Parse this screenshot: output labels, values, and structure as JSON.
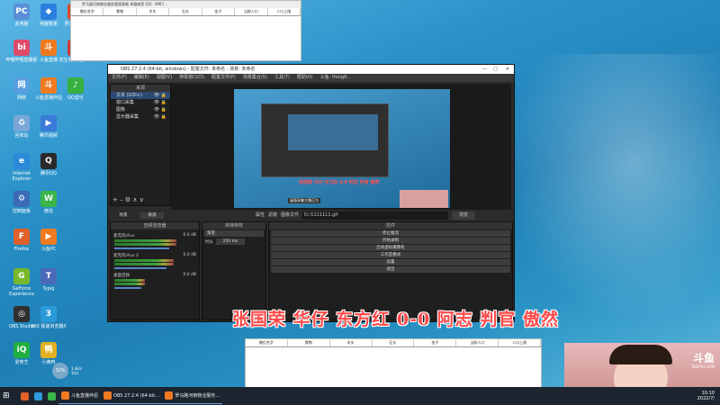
{
  "desktop_icons": [
    {
      "label": "此电脑",
      "color": "#5a8fd8",
      "glyph": "PC"
    },
    {
      "label": "电脑管家",
      "color": "#2a7fe0",
      "glyph": "◆"
    },
    {
      "label": "罗马路河南",
      "color": "#d84a2a",
      "glyph": "罗"
    },
    {
      "label": "哔哩哔哩直播姬",
      "color": "#e04a6a",
      "glyph": "bi"
    },
    {
      "label": "斗鱼直播",
      "color": "#f07a20",
      "glyph": "斗"
    },
    {
      "label": "花生壳 开始Live",
      "color": "#d23a3a",
      "glyph": "花"
    },
    {
      "label": "网络",
      "color": "#5aa0e0",
      "glyph": "网"
    },
    {
      "label": "斗鱼直播伴侣",
      "color": "#f07a20",
      "glyph": "斗"
    },
    {
      "label": "QQ音乐",
      "color": "#38b040",
      "glyph": "♪"
    },
    {
      "label": "回收站",
      "color": "#7aa7d8",
      "glyph": "♻"
    },
    {
      "label": "腾讯视频",
      "color": "#3a7ad8",
      "glyph": "▶"
    },
    {
      "label": "Internet Explorer",
      "color": "#2a8ad8",
      "glyph": "e"
    },
    {
      "label": "腾讯QQ",
      "color": "#2a2a2a",
      "glyph": "Q"
    },
    {
      "label": "控制面板",
      "color": "#3a6ab8",
      "glyph": "⚙"
    },
    {
      "label": "微信",
      "color": "#3ab54a",
      "glyph": "W"
    },
    {
      "label": "Firefox",
      "color": "#e0602a",
      "glyph": "F"
    },
    {
      "label": "斗鱼PC",
      "color": "#f07a20",
      "glyph": "▶"
    },
    {
      "label": "GeForce Experience",
      "color": "#76b82a",
      "glyph": "G"
    },
    {
      "label": "Typig",
      "color": "#4a6ab8",
      "glyph": "T"
    },
    {
      "label": "OBS Studio",
      "color": "#303030",
      "glyph": "◎"
    },
    {
      "label": "360 极速浏览器X",
      "color": "#2a9ad8",
      "glyph": "3"
    },
    {
      "label": "爱奇艺",
      "color": "#20b040",
      "glyph": "iQ"
    },
    {
      "label": "小黄鸭",
      "color": "#e0b020",
      "glyph": "鸭"
    }
  ],
  "top_sheet": {
    "title": "罗马路河南物业服务管理表格  承租商家   QQ：4967…",
    "columns": [
      "摊位名字",
      "食物",
      "木头",
      "石头",
      "金子",
      "当前人口",
      "人口上限"
    ]
  },
  "bottom_sheet": {
    "columns": [
      "摊位名字",
      "食物",
      "木头",
      "石头",
      "金子",
      "当前人口",
      "人口上限"
    ]
  },
  "obs": {
    "title": "OBS 27.2.4 (64-bit, windows) - 配置文件: 未命名 - 场景: 未命名",
    "menu": [
      "文件(F)",
      "编辑(E)",
      "视图(V)",
      "停靠窗口(D)",
      "配置文件(P)",
      "场景集合(S)",
      "工具(T)",
      "帮助(H)",
      "斗鱼: HongR..."
    ],
    "sources_header": "来源",
    "sources": [
      "文本 (GDI+)",
      "窗口采集",
      "图像",
      "显示器采集"
    ],
    "dock_tabs": [
      "场景",
      "来源"
    ],
    "scene_bar_labels": {
      "properties": "属性",
      "filters": "滤镜",
      "image_label": "图像文件",
      "path": "D:/1111111.gif",
      "browse": "浏览"
    },
    "mixer_header": "音频混音器",
    "mixer_channels": [
      {
        "name": "麦克风/Aux",
        "db": "0.0 dB",
        "level": 0.82
      },
      {
        "name": "麦克风/Aux 2",
        "db": "0.0 dB",
        "level": 0.78
      },
      {
        "name": "桌面音频",
        "db": "0.0 dB",
        "level": 0.4
      }
    ],
    "transition_header": "转场特效",
    "transition_type": "渐变",
    "duration_label": "时长",
    "duration_value": "250 ms",
    "controls_header": "控件",
    "controls": [
      "停止推流",
      "开始录制",
      "启动虚拟摄像机",
      "工作室模式",
      "设置",
      "退出"
    ],
    "preview_caption": "桌面采集主播正方",
    "preview_overlay": "张国荣 华仔 东方红 0-0 阿志 判官 傲然"
  },
  "stream_overlay_text": "张国荣 华仔 东方红 0-0 阿志 判官 傲然",
  "cam": {
    "brand": "斗鱼",
    "brand_sub": "DOUYU.COM",
    "room": "5913940"
  },
  "taskbar": {
    "items": [
      "斗鱼直播伴侣",
      "OBS 27.2.4 (64-bit…",
      "罗马路河南物业服务…"
    ],
    "time": "10:10",
    "date": "2022/7/"
  },
  "widget": {
    "percent": "32%",
    "up": "1.4k/s",
    "down": "1k/s"
  }
}
